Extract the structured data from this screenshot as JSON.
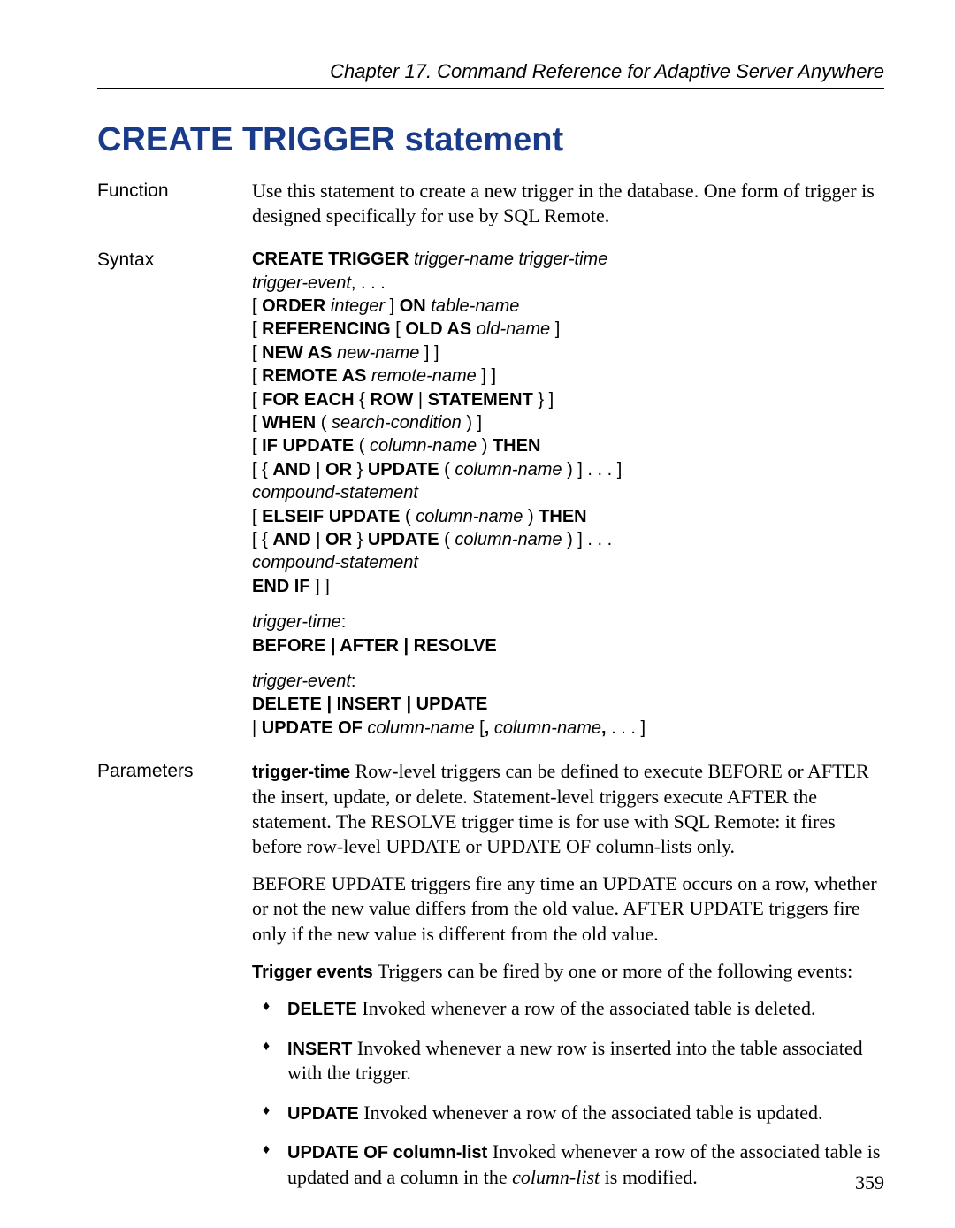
{
  "header": {
    "chapter": "Chapter 17.  Command Reference for Adaptive Server Anywhere"
  },
  "title": "CREATE TRIGGER statement",
  "function": {
    "label": "Function",
    "text": "Use this statement to create a new trigger in the database. One form of trigger is designed specifically for use by SQL Remote."
  },
  "syntax": {
    "label": "Syntax",
    "l1a": "CREATE TRIGGER",
    "l1b": " trigger-name trigger-time",
    "l2": "trigger-event",
    "l2s": ", . . .",
    "l3a": "[ ",
    "l3b": "ORDER",
    "l3c": " integer ",
    "l3d": "] ",
    "l3e": "ON",
    "l3f": " table-name",
    "l4a": "[ ",
    "l4b": "REFERENCING",
    "l4c": " [ ",
    "l4d": "OLD AS",
    "l4e": " old-name ",
    "l4f": "]",
    "l5a": "[ ",
    "l5b": "NEW AS",
    "l5c": " new-name ",
    "l5d": "] ]",
    "l6a": "[ ",
    "l6b": "REMOTE AS",
    "l6c": " remote-name ",
    "l6d": "] ]",
    "l7a": "[ ",
    "l7b": "FOR EACH",
    "l7c": " { ",
    "l7d": "ROW",
    "l7e": " | ",
    "l7f": "STATEMENT",
    "l7g": " } ]",
    "l8a": "[ ",
    "l8b": "WHEN",
    "l8c": " ( ",
    "l8d": "search-condition",
    "l8e": " ) ]",
    "l9a": "[ ",
    "l9b": "IF UPDATE",
    "l9c": " ( ",
    "l9d": "column-name",
    "l9e": " ) ",
    "l9f": "THEN",
    "l10a": "[ { ",
    "l10b": "AND",
    "l10c": " | ",
    "l10d": "OR",
    "l10e": " } ",
    "l10f": "UPDATE",
    "l10g": " ( ",
    "l10h": "column-name",
    "l10i": " ) ] . . . ]",
    "l11": "compound-statement",
    "l12a": "[ ",
    "l12b": "ELSEIF UPDATE",
    "l12c": " ( ",
    "l12d": "column-name",
    "l12e": " ) ",
    "l12f": "THEN",
    "l13a": "[ { ",
    "l13b": "AND",
    "l13c": " | ",
    "l13d": "OR",
    "l13e": " } ",
    "l13f": "UPDATE",
    "l13g": " ( ",
    "l13h": "column-name",
    "l13i": " ) ] . . .",
    "l14": " compound-statement",
    "l15": "END IF",
    "l15b": " ] ]",
    "tt_label": "trigger-time",
    "tt_colon": ":",
    "tt_val": "BEFORE | AFTER | RESOLVE",
    "te_label": "trigger-event",
    "te_colon": ":",
    "te_val": "DELETE | INSERT | UPDATE",
    "te2a": "| ",
    "te2b": "UPDATE OF",
    "te2c": " column-name ",
    "te2d": "[",
    "te2e": ", ",
    "te2f": "column-name",
    "te2g": ", ",
    "te2h": ". . . ]"
  },
  "parameters": {
    "label": "Parameters",
    "tt_term": "trigger-time",
    "tt_text": "   Row-level triggers can be defined to execute BEFORE or AFTER the insert, update, or delete. Statement-level triggers execute AFTER the statement. The RESOLVE trigger time is for use with SQL Remote: it fires before row-level UPDATE or UPDATE OF column-lists only.",
    "p2": "BEFORE UPDATE triggers fire any time an UPDATE occurs on a row, whether or not the new value differs from the old value. AFTER UPDATE triggers fire only if the new value is different from the old value.",
    "te_term": "Trigger events",
    "te_text": "   Triggers can be fired by one or more of the following events:",
    "events": {
      "delete": {
        "k": "DELETE",
        "t": "   Invoked whenever a row of the associated table is deleted."
      },
      "insert": {
        "k": "INSERT",
        "t": "   Invoked whenever a new row is inserted into the table associated with the trigger."
      },
      "update": {
        "k": "UPDATE",
        "t": "   Invoked whenever a row of the associated table is updated."
      },
      "updateof": {
        "k": "UPDATE OF column-list",
        "t1": "   Invoked whenever a row of the associated table is updated and a column in the ",
        "t2": "column-list",
        "t3": " is modified."
      }
    }
  },
  "page_number": "359"
}
